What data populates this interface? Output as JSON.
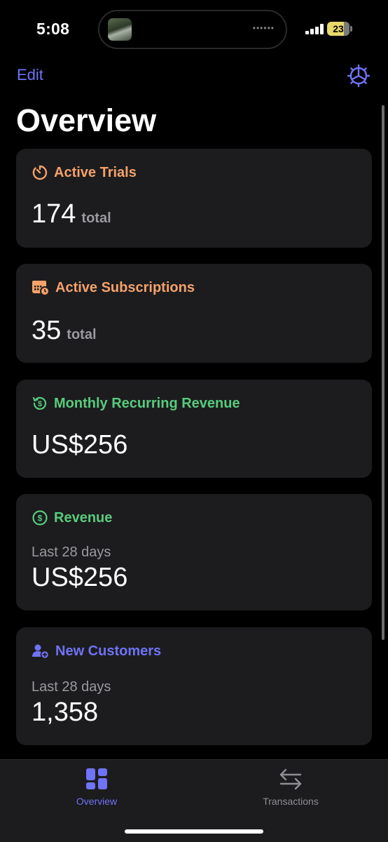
{
  "status_bar": {
    "time": "5:08",
    "battery": "23"
  },
  "nav": {
    "edit_label": "Edit"
  },
  "title": "Overview",
  "cards": [
    {
      "title": "Active Trials",
      "value": "174",
      "unit": "total",
      "icon": "timer-icon",
      "color": "#f4a26a"
    },
    {
      "title": "Active Subscriptions",
      "value": "35",
      "unit": "total",
      "icon": "calendar-clock-icon",
      "color": "#f4a26a"
    },
    {
      "title": "Monthly Recurring Revenue",
      "value": "US$256",
      "icon": "recurring-dollar-icon",
      "color": "#58cb7c"
    },
    {
      "title": "Revenue",
      "sublabel": "Last 28 days",
      "value": "US$256",
      "icon": "dollar-circle-icon",
      "color": "#58cb7c"
    },
    {
      "title": "New Customers",
      "sublabel": "Last 28 days",
      "value": "1,358",
      "icon": "person-add-icon",
      "color": "#6f73f5"
    }
  ],
  "tabs": [
    {
      "label": "Overview",
      "icon": "grid-dashboard-icon",
      "active": true
    },
    {
      "label": "Transactions",
      "icon": "arrows-swap-icon",
      "active": false
    }
  ],
  "colors": {
    "accent": "#6f73f5",
    "background": "#000000",
    "card": "#1c1c1e"
  }
}
